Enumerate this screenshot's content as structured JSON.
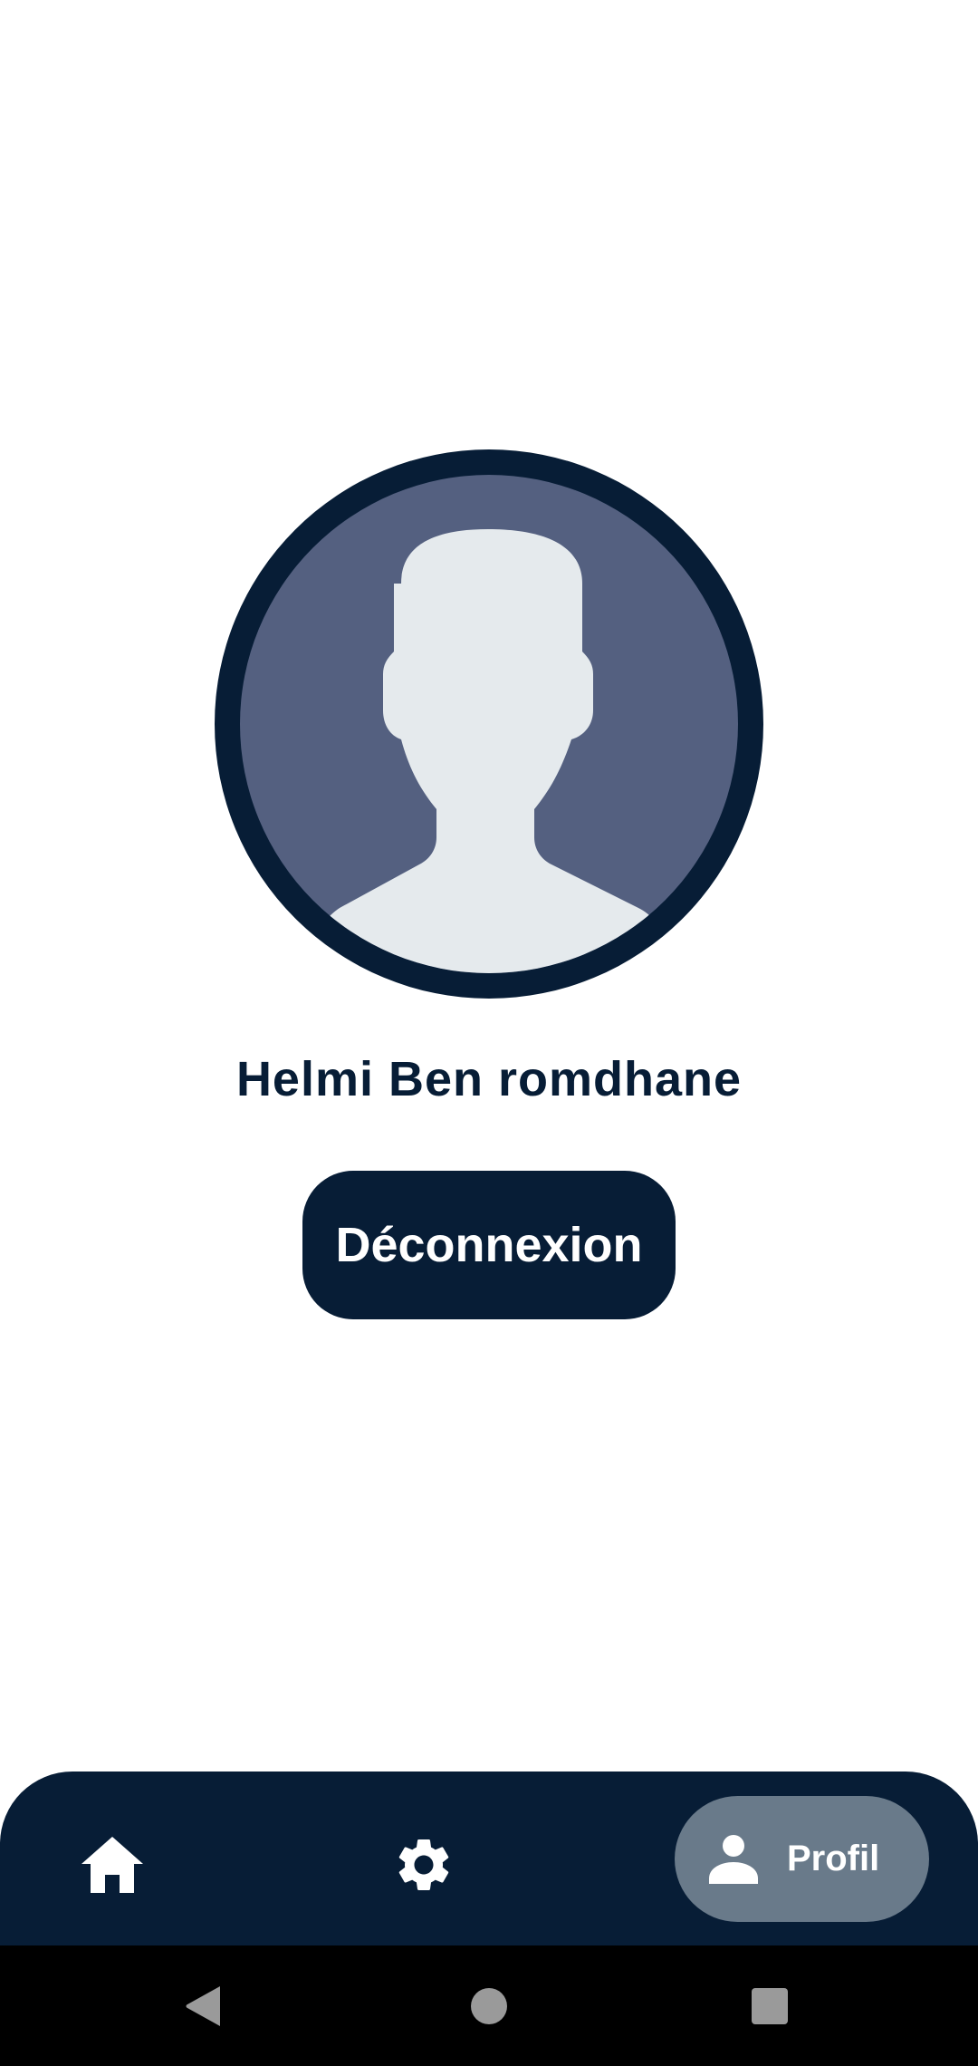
{
  "profile": {
    "user_name": "Helmi Ben romdhane",
    "avatar_icon": "default-user-silhouette"
  },
  "actions": {
    "logout_label": "Déconnexion"
  },
  "bottom_nav": {
    "items": [
      {
        "icon": "home-icon",
        "label": ""
      },
      {
        "icon": "gear-icon",
        "label": ""
      },
      {
        "icon": "person-icon",
        "label": "Profil",
        "selected": true
      }
    ]
  },
  "system_nav": {
    "buttons": [
      "back-icon",
      "home-circle-icon",
      "recents-icon"
    ]
  },
  "colors": {
    "primary": "#071d36",
    "avatar_bg": "#546080",
    "silhouette": "#e5eaed",
    "nav_selected": "#697a8a",
    "background": "#ffffff"
  }
}
